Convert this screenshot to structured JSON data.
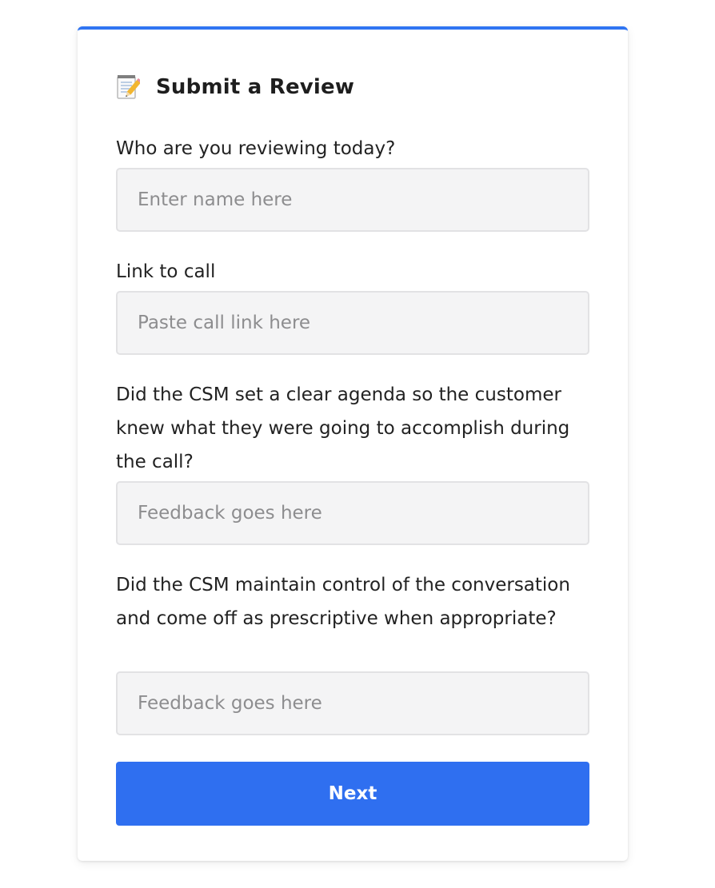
{
  "form": {
    "title": "Submit a Review",
    "title_icon": "memo-icon",
    "fields": [
      {
        "label": "Who are you reviewing today?",
        "placeholder": "Enter name here",
        "value": ""
      },
      {
        "label": "Link to call",
        "placeholder": "Paste call link here",
        "value": ""
      },
      {
        "label": "Did the CSM set a clear agenda so the customer knew what they were going to accomplish during the call?",
        "placeholder": "Feedback goes here",
        "value": ""
      },
      {
        "label": "Did the CSM maintain control of the conversation and come off as prescriptive when appropriate?",
        "placeholder": "Feedback goes here",
        "value": ""
      }
    ],
    "next_label": "Next"
  },
  "colors": {
    "accent": "#2f74f2",
    "button": "#2f6ff0",
    "field_bg": "#f4f4f5",
    "field_border": "#e2e2e4"
  }
}
